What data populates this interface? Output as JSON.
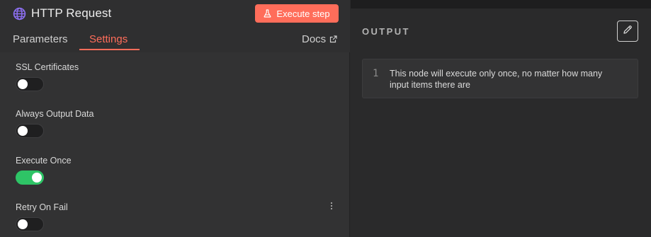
{
  "node": {
    "title": "HTTP Request",
    "icon": "globe-icon",
    "execute_label": "Execute step",
    "accent_color": "#ff6d5a"
  },
  "tabs": {
    "parameters": "Parameters",
    "settings": "Settings",
    "docs": "Docs",
    "active": "Settings"
  },
  "settings": [
    {
      "label": "SSL Certificates",
      "enabled": false
    },
    {
      "label": "Always Output Data",
      "enabled": false
    },
    {
      "label": "Execute Once",
      "enabled": true
    },
    {
      "label": "Retry On Fail",
      "enabled": false
    }
  ],
  "output": {
    "title": "OUTPUT",
    "line_number": "1",
    "message": "This node will execute only once, no matter how many input items there are"
  },
  "colors": {
    "toggle_on": "#2ec466",
    "toggle_off": "#1f1f20"
  }
}
